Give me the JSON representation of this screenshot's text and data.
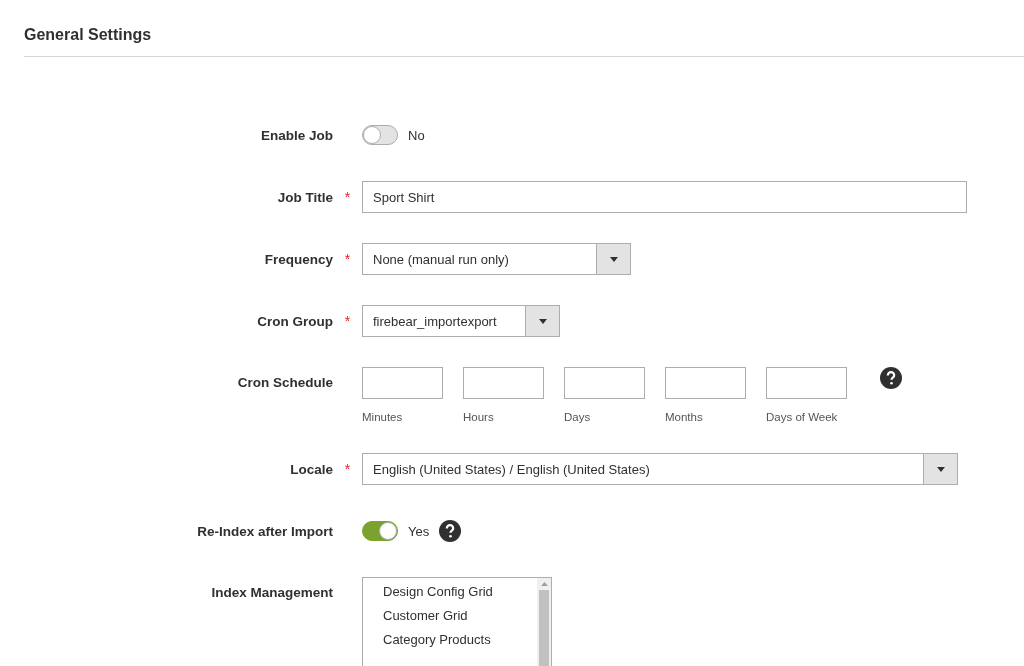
{
  "section": {
    "title": "General Settings"
  },
  "fields": [
    {
      "kind": "toggle",
      "label": "Enable Job",
      "on": false,
      "state_label": "No"
    },
    {
      "kind": "text",
      "label": "Job Title",
      "required_mark": "*",
      "value": "Sport Shirt"
    },
    {
      "kind": "select",
      "label": "Frequency",
      "required_mark": "*",
      "value": "None (manual run only)"
    },
    {
      "kind": "select",
      "label": "Cron Group",
      "required_mark": "*",
      "value": "firebear_importexport"
    },
    {
      "kind": "schedule",
      "label": "Cron Schedule",
      "parts": [
        "Minutes",
        "Hours",
        "Days",
        "Months",
        "Days of Week"
      ],
      "help": true
    },
    {
      "kind": "select",
      "label": "Locale",
      "required_mark": "*",
      "value": "English (United States) / English (United States)"
    },
    {
      "kind": "toggle",
      "label": "Re-Index after Import",
      "on": true,
      "state_label": "Yes",
      "help": true
    },
    {
      "kind": "multiselect",
      "label": "Index Management",
      "options": [
        "Design Config Grid",
        "Customer Grid",
        "Category Products"
      ]
    }
  ]
}
